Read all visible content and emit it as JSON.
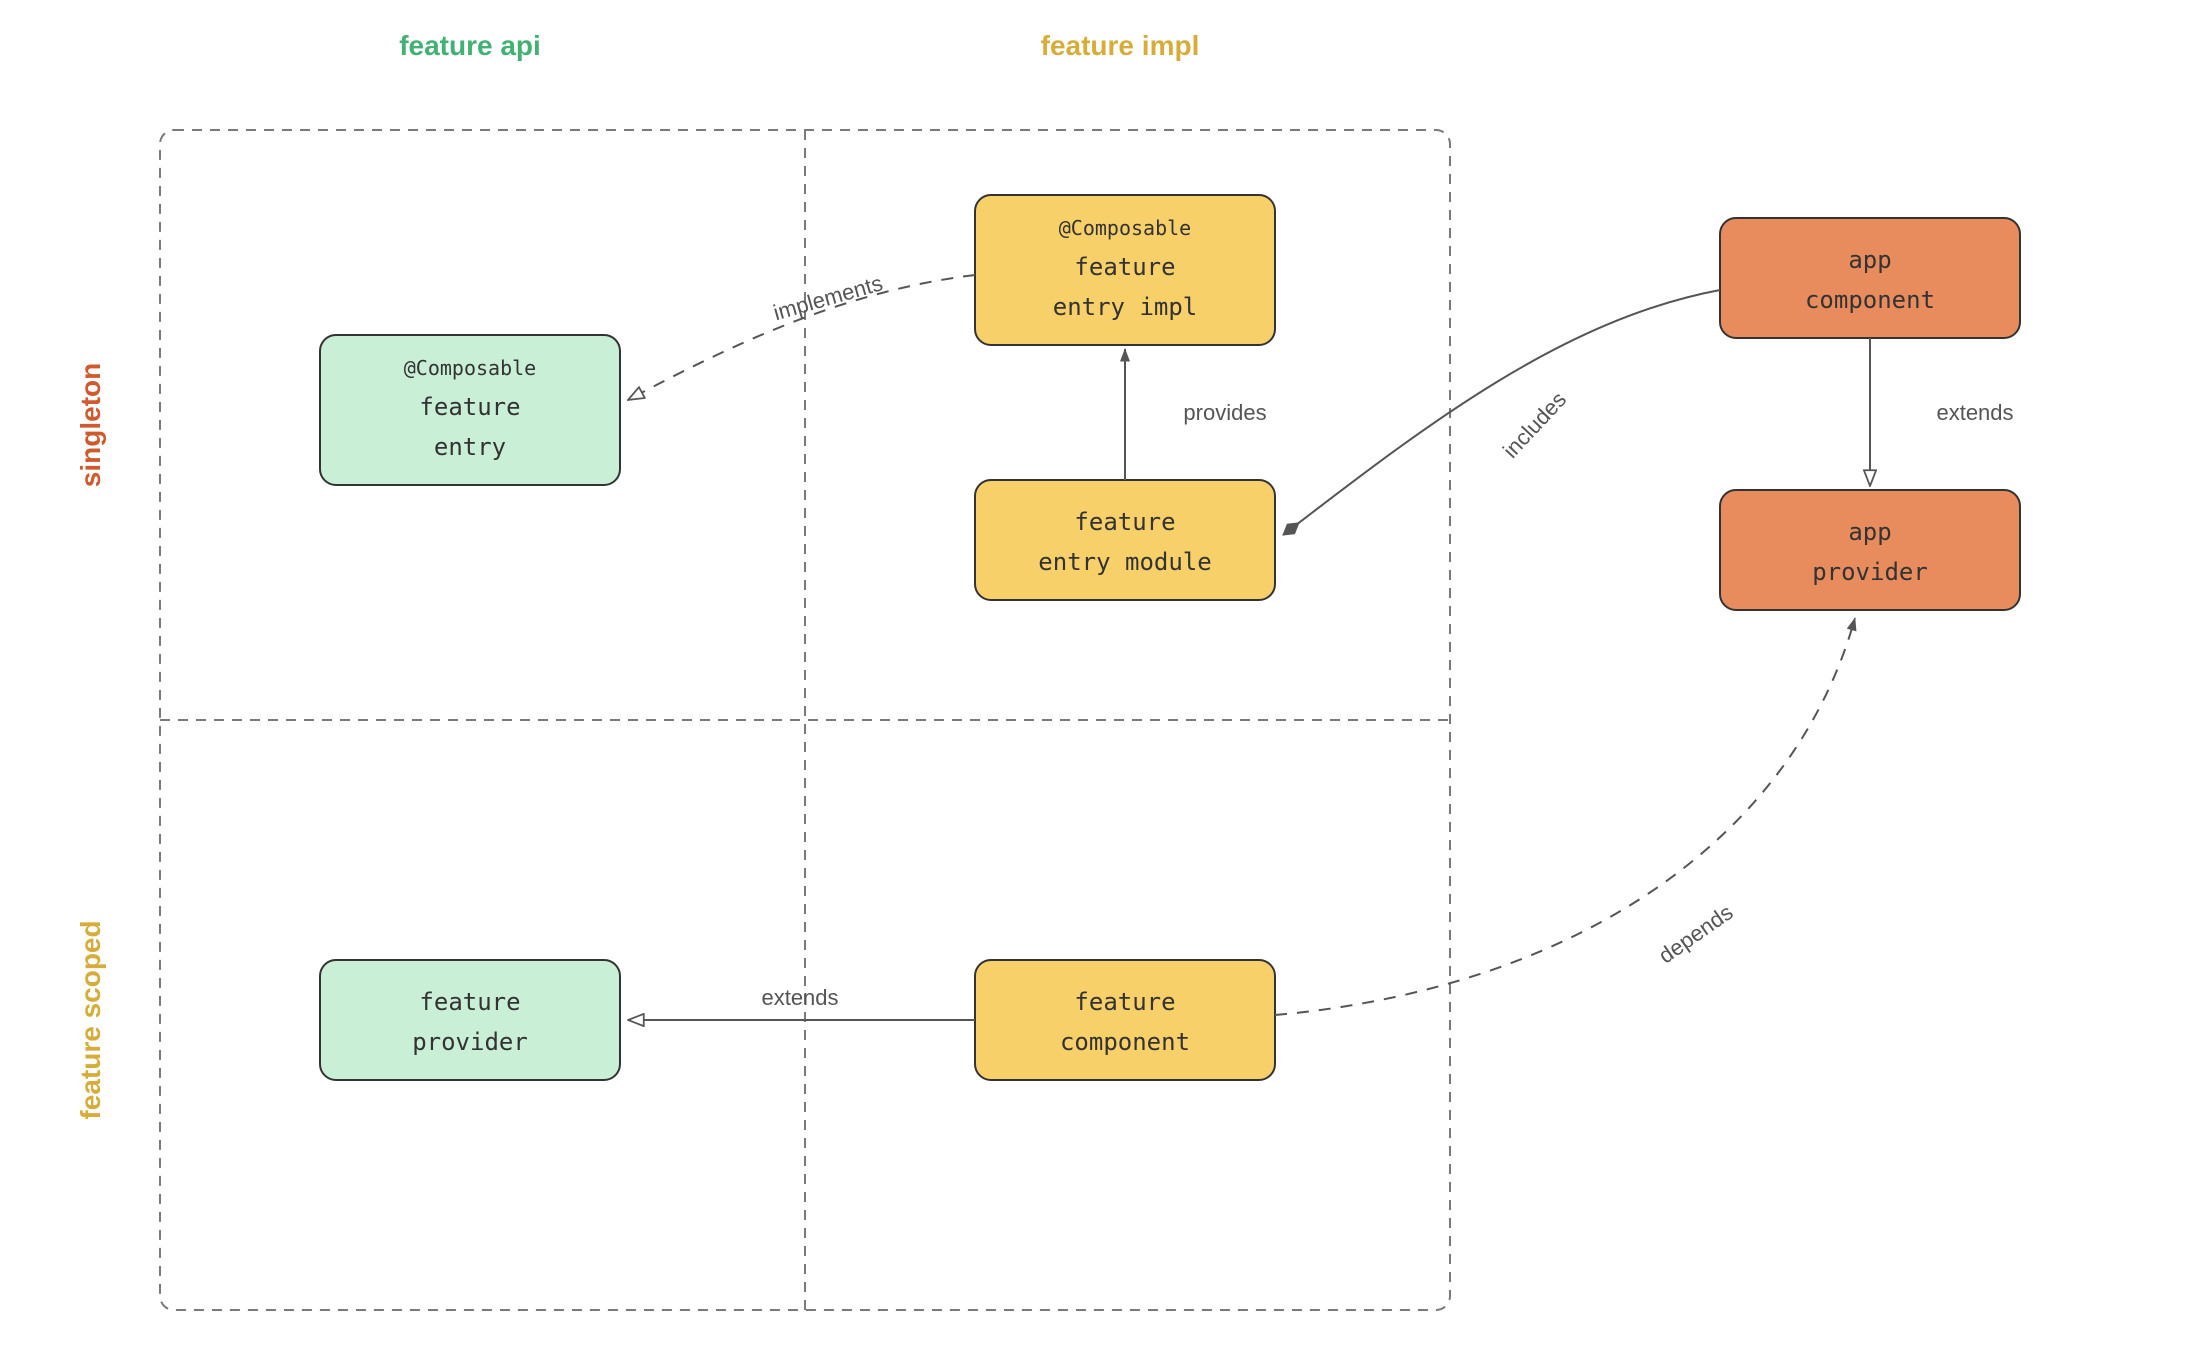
{
  "columns": {
    "api": {
      "label": "feature api",
      "color": "#43b074"
    },
    "impl": {
      "label": "feature impl",
      "color": "#d6ad3a"
    }
  },
  "rows": {
    "singleton": {
      "label": "singleton",
      "color": "#cf5a2f"
    },
    "scoped": {
      "label": "feature scoped",
      "color": "#d6ad3a"
    }
  },
  "nodes": {
    "feature_entry": {
      "annotation": "@Composable",
      "line1": "feature",
      "line2": "entry"
    },
    "feature_entry_impl": {
      "annotation": "@Composable",
      "line1": "feature",
      "line2": "entry impl"
    },
    "feature_entry_module": {
      "line1": "feature",
      "line2": "entry module"
    },
    "feature_provider": {
      "line1": "feature",
      "line2": "provider"
    },
    "feature_component": {
      "line1": "feature",
      "line2": "component"
    },
    "app_component": {
      "line1": "app",
      "line2": "component"
    },
    "app_provider": {
      "line1": "app",
      "line2": "provider"
    }
  },
  "edges": {
    "implements": "implements",
    "provides": "provides",
    "includes": "includes",
    "extends_app": "extends",
    "extends_feature": "extends",
    "depends": "depends"
  }
}
